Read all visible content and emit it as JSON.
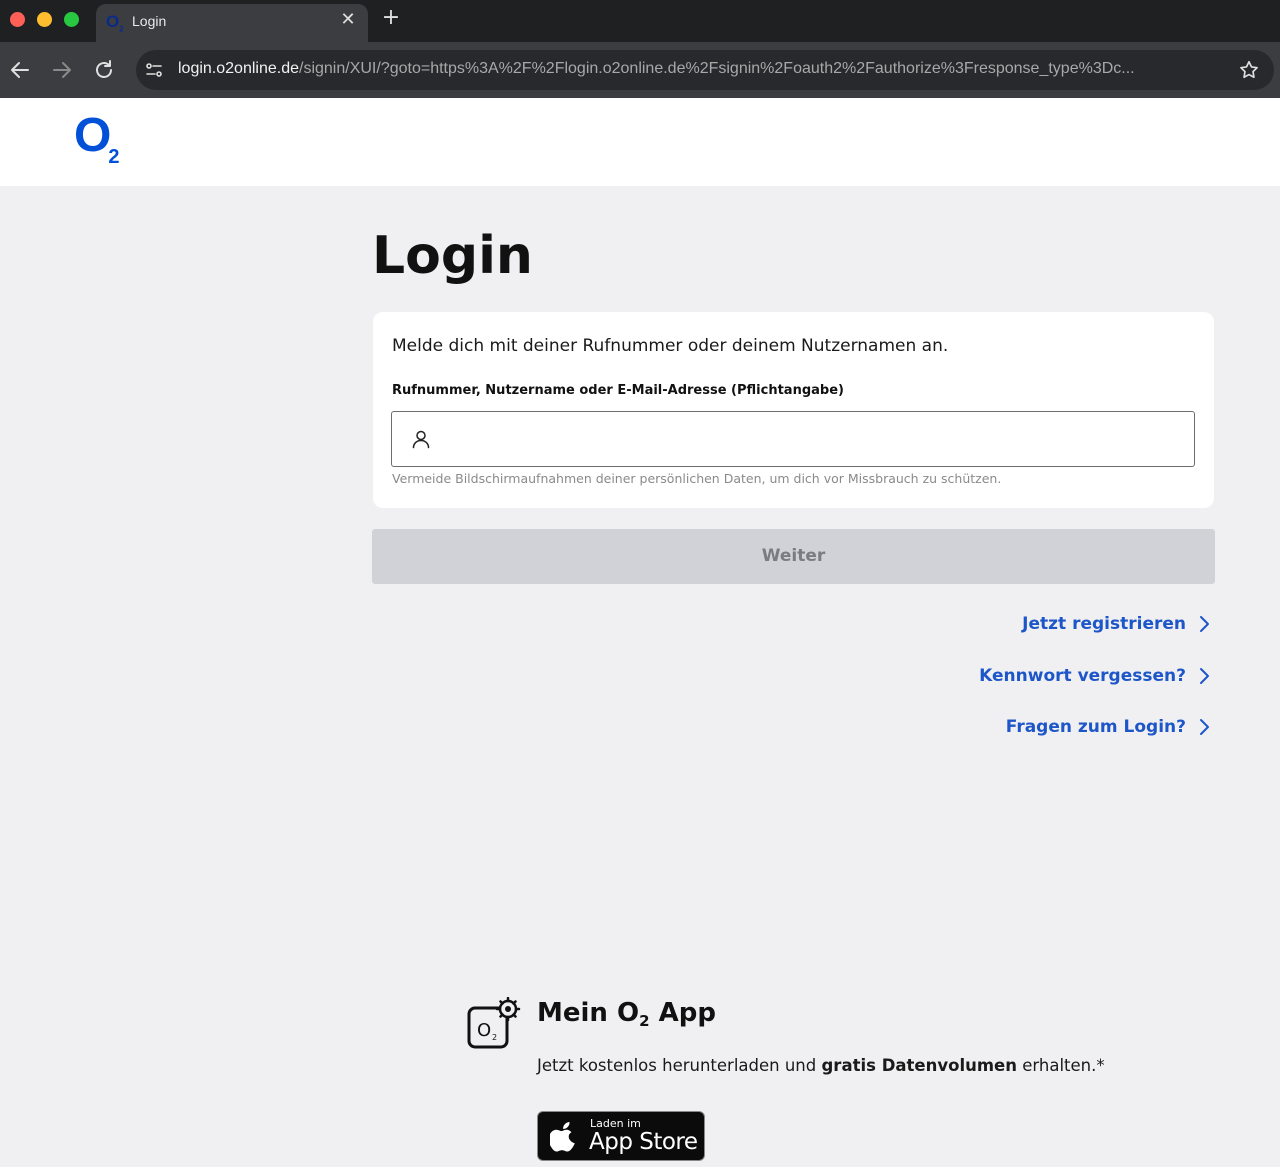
{
  "browser": {
    "tab_title": "Login",
    "favicon_letter": "O",
    "favicon_sub": "2",
    "close_glyph": "✕",
    "new_tab_glyph": "+",
    "url_host": "login.o2online.de",
    "url_path": "/signin/XUI/?goto=https%3A%2F%2Flogin.o2online.de%2Fsignin%2Foauth2%2Fauthorize%3Fresponse_type%3Dc..."
  },
  "header": {
    "logo_letter": "O",
    "logo_sub": "2"
  },
  "login": {
    "title": "Login",
    "intro": "Melde dich mit deiner Rufnummer oder deinem Nutzernamen an.",
    "field_label": "Rufnummer, Nutzername oder E-Mail-Adresse (Pflichtangabe)",
    "field_value": "",
    "helper": "Vermeide Bildschirmaufnahmen deiner persönlichen Daten, um dich vor Missbrauch zu schützen.",
    "submit_label": "Weiter"
  },
  "links": [
    {
      "label": "Jetzt registrieren"
    },
    {
      "label": "Kennwort vergessen?"
    },
    {
      "label": "Fragen zum Login?"
    }
  ],
  "app_promo": {
    "title_pre": "Mein O",
    "title_sub": "2",
    "title_post": " App",
    "text_pre": "Jetzt kostenlos herunterladen und ",
    "text_bold": "gratis Datenvolumen",
    "text_post": " erhalten.*",
    "store_small": "Laden im",
    "store_big": "App Store"
  },
  "colors": {
    "brand_blue": "#0050d8",
    "link_blue": "#1c56c8",
    "disabled_button": "#d0d2d8",
    "page_background": "#f0f0f2"
  },
  "icons": [
    "back-arrow-icon",
    "forward-arrow-icon",
    "reload-icon",
    "site-info-icon",
    "bookmark-star-icon",
    "user-icon",
    "chevron-right-icon",
    "o2-app-icon",
    "apple-icon"
  ]
}
